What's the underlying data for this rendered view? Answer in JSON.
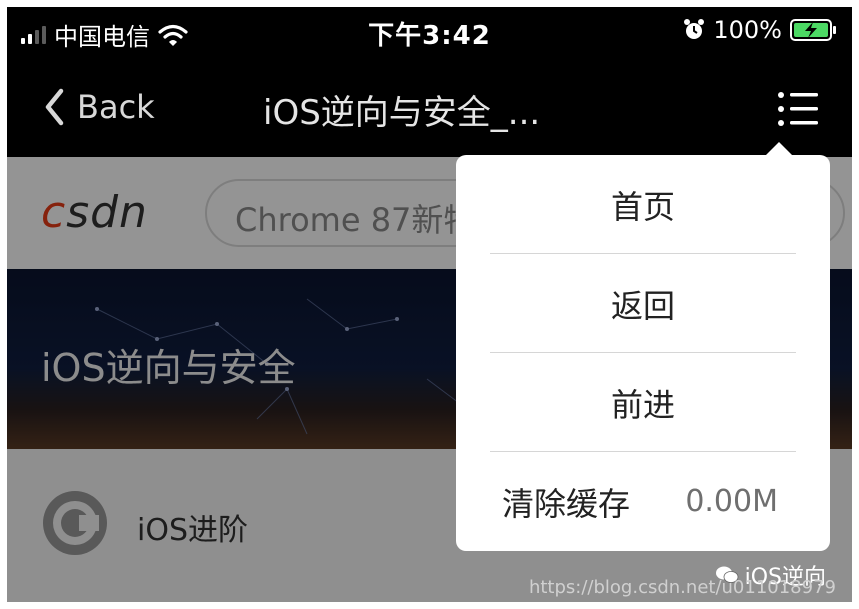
{
  "status_bar": {
    "carrier": "中国电信",
    "time": "下午3:42",
    "battery": "100%",
    "icons": [
      "signal-icon",
      "wifi-icon",
      "alarm-icon",
      "battery-charging-icon"
    ]
  },
  "nav": {
    "back_label": "Back",
    "title": "iOS逆向与安全_...",
    "icons": [
      "chevron-left-icon",
      "list-menu-icon"
    ]
  },
  "page": {
    "logo": {
      "first": "c",
      "rest": "sdn"
    },
    "search_text": "Chrome 87新特",
    "banner_title": "iOS逆向与安全",
    "row_label": "iOS进阶"
  },
  "menu": {
    "items": [
      "首页",
      "返回",
      "前进"
    ],
    "clear_cache_label": "清除缓存",
    "cache_size": "0.00M"
  },
  "watermark": {
    "brand": "iOS逆向",
    "url": "https://blog.csdn.net/u011018979"
  },
  "colors": {
    "csdn_red": "#e73b17",
    "battery_green": "#4cd964"
  }
}
